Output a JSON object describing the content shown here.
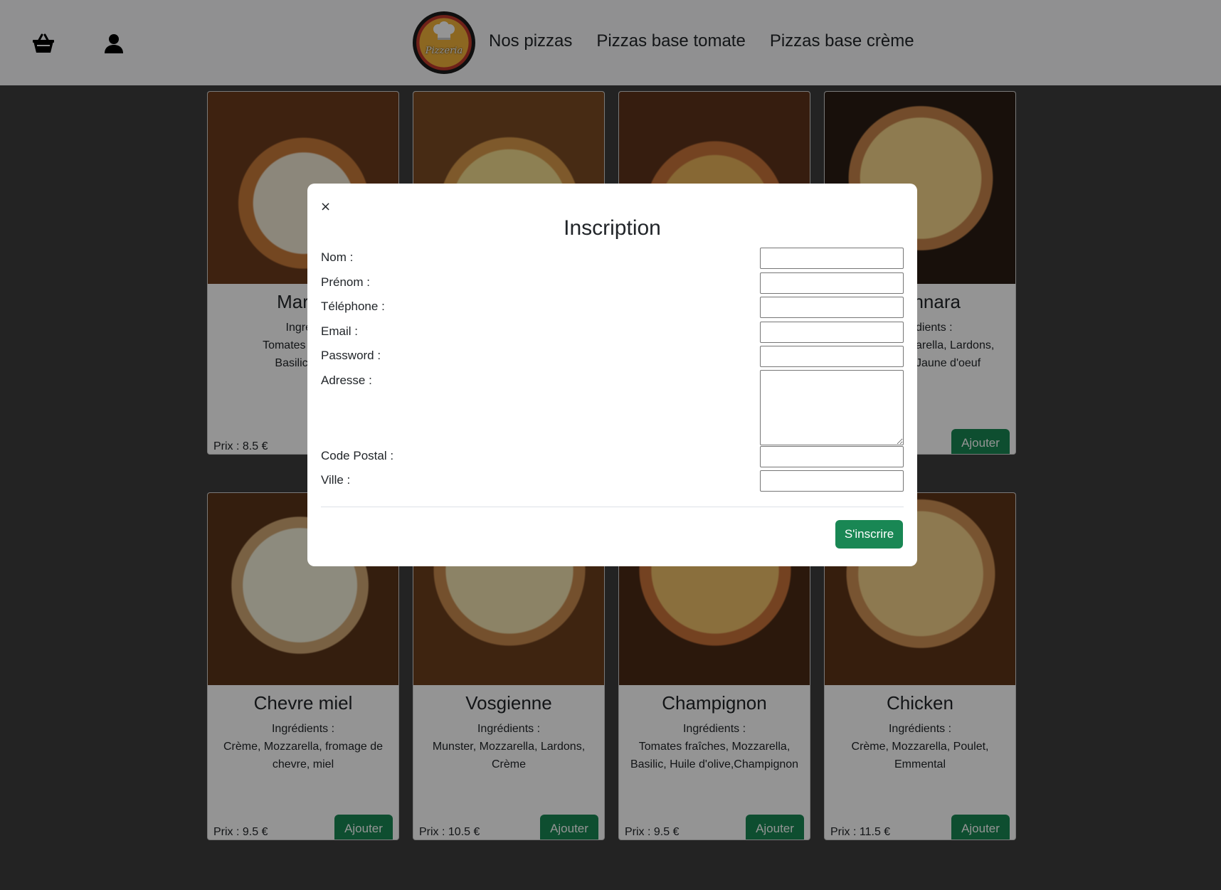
{
  "nav": {
    "logo_text": "Pizzeria",
    "links": [
      "Nos pizzas",
      "Pizzas base tomate",
      "Pizzas base crème"
    ],
    "icons": [
      "basket-icon",
      "user-icon"
    ]
  },
  "cards": [
    {
      "name": "Margh",
      "ingredients_label": "Ingrédi",
      "ingredients": "Tomates fraîche\nBasilic, Hui",
      "price": "Prix : 8.5 €",
      "button": ""
    },
    {
      "name": "",
      "ingredients_label": "",
      "ingredients": "",
      "price": "",
      "button": ""
    },
    {
      "name": "",
      "ingredients_label": "",
      "ingredients": "",
      "price": "",
      "button": ""
    },
    {
      "name": "onnara",
      "ingredients_label": "dients :",
      "ingredients": "arella, Lardons,\nJaune d'oeuf",
      "price": "",
      "button": "Ajouter"
    },
    {
      "name": "Chevre miel",
      "ingredients_label": "Ingrédients :",
      "ingredients": "Crème, Mozzarella, fromage de chevre, miel",
      "price": "Prix : 9.5 €",
      "button": "Ajouter"
    },
    {
      "name": "Vosgienne",
      "ingredients_label": "Ingrédients :",
      "ingredients": "Munster, Mozzarella, Lardons, Crème",
      "price": "Prix : 10.5 €",
      "button": "Ajouter"
    },
    {
      "name": "Champignon",
      "ingredients_label": "Ingrédients :",
      "ingredients": "Tomates fraîches, Mozzarella, Basilic, Huile d'olive,Champignon",
      "price": "Prix : 9.5 €",
      "button": "Ajouter"
    },
    {
      "name": "Chicken",
      "ingredients_label": "Ingrédients :",
      "ingredients": "Crème, Mozzarella, Poulet, Emmental",
      "price": "Prix : 11.5 €",
      "button": "Ajouter"
    }
  ],
  "modal": {
    "close": "×",
    "title": "Inscription",
    "fields": {
      "nom": "Nom :",
      "prenom": "Prénom :",
      "telephone": "Téléphone :",
      "email": "Email :",
      "password": "Password :",
      "adresse": "Adresse :",
      "code_postal": "Code Postal :",
      "ville": "Ville :"
    },
    "submit": "S'inscrire"
  },
  "colors": {
    "primary_button": "#198754",
    "navbar": "#f8f9fa",
    "backdrop": "#3d3d3d"
  }
}
